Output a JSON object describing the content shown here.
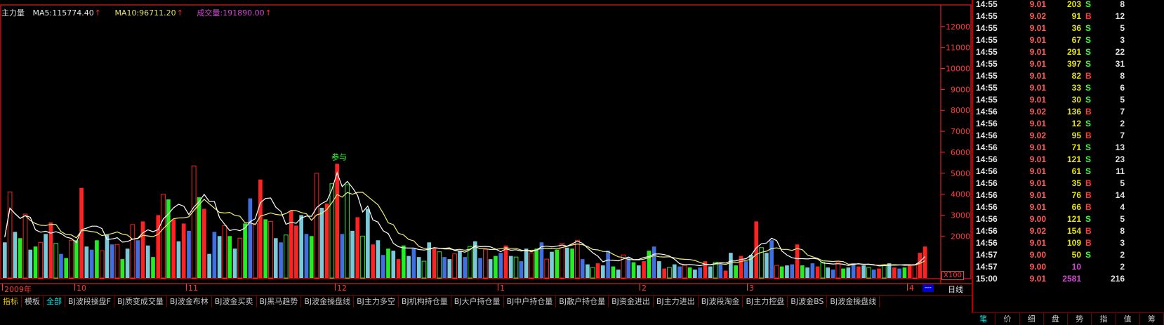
{
  "indicator": {
    "title": "主力量",
    "ma5_label": "MA5:115774.40",
    "ma10_label": "MA10:96711.20",
    "vol_label": "成交量:191890.00",
    "arrow": "↑"
  },
  "colors": {
    "background": "#000000",
    "frame": "#ff2a2a",
    "up": "#ff2222",
    "down": "#22ee22",
    "blue": "#3f6fe0",
    "cyan": "#79c9d9",
    "ma5": "#ffffff",
    "ma10": "#f2f07a"
  },
  "annotation": "参与",
  "chart_data": {
    "type": "bar",
    "ylabel": "",
    "unit_label": "X100",
    "y_ticks": [
      2000,
      3000,
      4000,
      5000,
      6000,
      7000,
      8000,
      9000,
      10000,
      11000,
      12000
    ],
    "ylim": [
      0,
      13000
    ],
    "x_labels": [
      "2009年",
      "10",
      "11",
      "12",
      "1",
      "2",
      "3",
      "4"
    ],
    "values": [
      1700,
      4100,
      2200,
      1900,
      3050,
      1350,
      1500,
      1700,
      2100,
      2650,
      1650,
      1150,
      950,
      1800,
      1800,
      4300,
      1500,
      1350,
      1800,
      1300,
      2050,
      1600,
      1600,
      900,
      1400,
      2550,
      1800,
      2700,
      1550,
      1000,
      3000,
      4000,
      3750,
      2800,
      1750,
      2600,
      2250,
      5350,
      3850,
      3300,
      1150,
      2200,
      2000,
      2500,
      2000,
      1400,
      1900,
      2600,
      3800,
      2600,
      4700,
      2800,
      2700,
      1900,
      1700,
      2050,
      3200,
      2500,
      3000,
      2100,
      2000,
      5000,
      3350,
      3550,
      4500,
      5450,
      2100,
      4450,
      2250,
      2900,
      2000,
      3300,
      1600,
      1800,
      1100,
      1400,
      1300,
      900,
      1550,
      1050,
      1400,
      1000,
      800,
      1700,
      1400,
      1250,
      1000,
      900,
      1150,
      1300,
      1000,
      1500,
      1750,
      950,
      1350,
      900,
      1050,
      1200,
      1550,
      1050,
      1000,
      800,
      1400,
      1200,
      1400,
      1700,
      900,
      1250,
      1350,
      1650,
      1450,
      1400,
      1800,
      900,
      650,
      500,
      700,
      600,
      1300,
      550,
      400,
      1100,
      1000,
      750,
      600,
      800,
      1300,
      1500,
      800,
      450,
      500,
      650,
      550,
      600,
      500,
      400,
      500,
      800,
      550,
      750,
      650,
      350,
      1200,
      600,
      1050,
      800,
      1100,
      2700,
      1450,
      1200,
      1800,
      600,
      550,
      600,
      650,
      1600,
      600,
      500,
      700,
      550,
      750,
      500,
      400,
      750,
      450,
      500,
      700,
      550,
      600,
      500,
      400,
      450,
      600,
      700,
      500,
      450,
      500,
      600,
      650,
      1200,
      1500
    ],
    "types": [
      "c",
      "r",
      "c",
      "g",
      "r",
      "c",
      "g",
      "r",
      "c",
      "r",
      "g",
      "b",
      "g",
      "r",
      "g",
      "r",
      "c",
      "b",
      "g",
      "r",
      "c",
      "b",
      "r",
      "g",
      "c",
      "r",
      "b",
      "r",
      "c",
      "g",
      "r",
      "r",
      "g",
      "r",
      "c",
      "r",
      "b",
      "r",
      "g",
      "r",
      "c",
      "b",
      "c",
      "r",
      "g",
      "c",
      "r",
      "g",
      "b",
      "r",
      "r",
      "g",
      "r",
      "c",
      "b",
      "g",
      "r",
      "r",
      "c",
      "b",
      "g",
      "r",
      "c",
      "r",
      "g",
      "r",
      "b",
      "g",
      "c",
      "r",
      "g",
      "c",
      "r",
      "c",
      "b",
      "g",
      "c",
      "r",
      "g",
      "c",
      "b",
      "c",
      "g",
      "c",
      "r",
      "g",
      "b",
      "c",
      "r",
      "c",
      "b",
      "g",
      "c",
      "b",
      "r",
      "c",
      "g",
      "b",
      "r",
      "c",
      "g",
      "b",
      "c",
      "r",
      "g",
      "b",
      "r",
      "c",
      "g",
      "r",
      "c",
      "g",
      "r",
      "b",
      "c",
      "g",
      "r",
      "c",
      "b",
      "g",
      "c",
      "r",
      "b",
      "g",
      "c",
      "r",
      "g",
      "b",
      "c",
      "r",
      "g",
      "c",
      "b",
      "r",
      "g",
      "c",
      "b",
      "r",
      "c",
      "g",
      "b",
      "r",
      "c",
      "g",
      "r",
      "b",
      "c",
      "r",
      "g",
      "c",
      "b",
      "r",
      "g",
      "c",
      "b",
      "r",
      "g",
      "c",
      "b",
      "r",
      "g",
      "c",
      "b",
      "r",
      "g",
      "c",
      "b",
      "r",
      "c",
      "g",
      "b",
      "r",
      "g",
      "c",
      "r",
      "b",
      "g",
      "r"
    ]
  },
  "period": "日线",
  "scroll_btn": "---",
  "tabs": [
    {
      "label": "指标",
      "state": "special"
    },
    {
      "label": "模板",
      "state": ""
    },
    {
      "label": "全部",
      "state": "active"
    },
    {
      "label": "BJ波段操盘F",
      "state": ""
    },
    {
      "label": "BJ质变成交量",
      "state": ""
    },
    {
      "label": "BJ波金布林",
      "state": ""
    },
    {
      "label": "BJ波金买卖",
      "state": ""
    },
    {
      "label": "BJ黑马趋势",
      "state": ""
    },
    {
      "label": "BJ波金操盘线",
      "state": ""
    },
    {
      "label": "BJ主力多空",
      "state": ""
    },
    {
      "label": "BJ机构持仓量",
      "state": ""
    },
    {
      "label": "BJ大户持仓量",
      "state": ""
    },
    {
      "label": "BJ中户持仓量",
      "state": ""
    },
    {
      "label": "BJ散户持仓量",
      "state": ""
    },
    {
      "label": "BJ资金进出",
      "state": ""
    },
    {
      "label": "BJ主力进出",
      "state": ""
    },
    {
      "label": "BJ波段淘金",
      "state": ""
    },
    {
      "label": "BJ主力控盘",
      "state": ""
    },
    {
      "label": "BJ波金BS",
      "state": ""
    },
    {
      "label": "BJ波金操盘线",
      "state": ""
    }
  ],
  "ticks": [
    {
      "time": "14:55",
      "price": "9.01",
      "vol": "203",
      "side": "S",
      "num": "8"
    },
    {
      "time": "14:55",
      "price": "9.02",
      "vol": "91",
      "side": "B",
      "num": "12"
    },
    {
      "time": "14:55",
      "price": "9.01",
      "vol": "36",
      "side": "S",
      "num": "5"
    },
    {
      "time": "14:55",
      "price": "9.01",
      "vol": "67",
      "side": "S",
      "num": "3"
    },
    {
      "time": "14:55",
      "price": "9.01",
      "vol": "291",
      "side": "S",
      "num": "22"
    },
    {
      "time": "14:55",
      "price": "9.01",
      "vol": "397",
      "side": "S",
      "num": "31"
    },
    {
      "time": "14:55",
      "price": "9.01",
      "vol": "82",
      "side": "B",
      "num": "8"
    },
    {
      "time": "14:55",
      "price": "9.01",
      "vol": "33",
      "side": "S",
      "num": "6"
    },
    {
      "time": "14:55",
      "price": "9.01",
      "vol": "30",
      "side": "S",
      "num": "5"
    },
    {
      "time": "14:56",
      "price": "9.02",
      "vol": "136",
      "side": "B",
      "num": "7"
    },
    {
      "time": "14:56",
      "price": "9.01",
      "vol": "12",
      "side": "S",
      "num": "2"
    },
    {
      "time": "14:56",
      "price": "9.02",
      "vol": "95",
      "side": "B",
      "num": "7"
    },
    {
      "time": "14:56",
      "price": "9.01",
      "vol": "71",
      "side": "S",
      "num": "13"
    },
    {
      "time": "14:56",
      "price": "9.01",
      "vol": "121",
      "side": "S",
      "num": "23"
    },
    {
      "time": "14:56",
      "price": "9.01",
      "vol": "61",
      "side": "S",
      "num": "11"
    },
    {
      "time": "14:56",
      "price": "9.01",
      "vol": "35",
      "side": "B",
      "num": "5"
    },
    {
      "time": "14:56",
      "price": "9.01",
      "vol": "76",
      "side": "B",
      "num": "14"
    },
    {
      "time": "14:56",
      "price": "9.01",
      "vol": "66",
      "side": "B",
      "num": "4"
    },
    {
      "time": "14:56",
      "price": "9.00",
      "vol": "121",
      "side": "S",
      "num": "5"
    },
    {
      "time": "14:56",
      "price": "9.02",
      "vol": "154",
      "side": "B",
      "num": "8"
    },
    {
      "time": "14:56",
      "price": "9.01",
      "vol": "109",
      "side": "B",
      "num": "3"
    },
    {
      "time": "14:57",
      "price": "9.00",
      "vol": "50",
      "side": "S",
      "num": "2"
    },
    {
      "time": "14:57",
      "price": "9.00",
      "vol": "10",
      "side": "",
      "num": "2"
    },
    {
      "time": "15:00",
      "price": "9.01",
      "vol": "2581",
      "side": "",
      "num": "216"
    }
  ],
  "side_tabs": [
    {
      "label": "笔",
      "state": "active"
    },
    {
      "label": "价",
      "state": ""
    },
    {
      "label": "细",
      "state": ""
    },
    {
      "label": "盘",
      "state": ""
    },
    {
      "label": "势",
      "state": ""
    },
    {
      "label": "指",
      "state": ""
    },
    {
      "label": "值",
      "state": ""
    },
    {
      "label": "筹",
      "state": ""
    }
  ]
}
